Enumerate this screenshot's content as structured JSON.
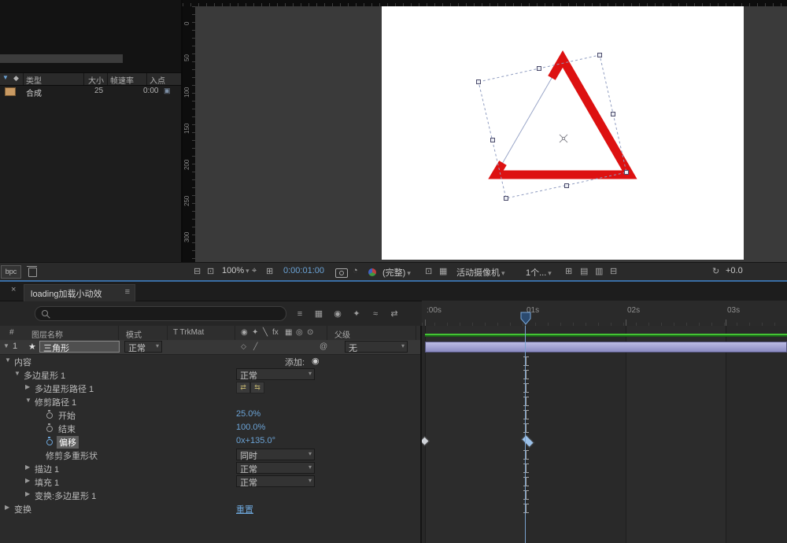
{
  "project": {
    "columns": [
      "类型",
      "大小",
      "帧速率",
      "入点"
    ],
    "row": {
      "label": "合成",
      "framerate": "25",
      "inpoint": "0:00"
    },
    "bpc_label": "bpc"
  },
  "viewer": {
    "vruler_labels": [
      "0",
      "50",
      "100",
      "150",
      "200",
      "250",
      "300"
    ],
    "toolbar": {
      "zoom": "100%",
      "timecode": "0:00:01:00",
      "resolution": "(完整)",
      "camera_view": "活动摄像机",
      "view_layout": "1个...",
      "exposure": "+0.0"
    }
  },
  "timeline": {
    "tab_label": "loading加载小动效",
    "columns": {
      "index": "#",
      "name": "图层名称",
      "mode": "模式",
      "trkmat": "T TrkMat",
      "parent": "父级"
    },
    "layer": {
      "index": "1",
      "name": "三角形",
      "mode": "正常",
      "parent": "无"
    },
    "add_label": "添加:",
    "ruler_labels": [
      ":00s",
      "01s",
      "02s",
      "03s"
    ],
    "rows": [
      {
        "label": "内容",
        "expander": "▼"
      },
      {
        "label": "多边星形 1",
        "expander": "▼",
        "value": "正常"
      },
      {
        "label": "多边星形路径 1",
        "expander": "▶"
      },
      {
        "label": "修剪路径 1",
        "expander": "▼"
      },
      {
        "label": "开始",
        "value": "25.0%"
      },
      {
        "label": "结束",
        "value": "100.0%"
      },
      {
        "label": "偏移",
        "value": "0x+135.0°"
      },
      {
        "label": "修剪多重形状",
        "value": "同时"
      },
      {
        "label": "描边 1",
        "expander": "▶",
        "value": "正常"
      },
      {
        "label": "填充 1",
        "expander": "▶",
        "value": "正常"
      },
      {
        "label": "变换:多边星形 1",
        "expander": "▶"
      },
      {
        "label": "变换",
        "expander": "▶",
        "value": "重置"
      }
    ]
  },
  "icons": {
    "close": "×",
    "menu": "≡",
    "dropdown": "▾",
    "twirl_open": "▼",
    "twirl_closed": "▶",
    "tag": "◆",
    "star": "★",
    "add_button": "◉",
    "reverse_a": "⇄",
    "reverse_b": "⇆",
    "pickwhip": "@",
    "blend_a": "◇",
    "blend_b": "╱",
    "comp_item": "▣",
    "monitor_a": "⊟",
    "monitor_b": "⊡",
    "region": "⌖",
    "grid": "⊞",
    "snapshot_show": "◔",
    "roi": "⊡",
    "transparency": "▦",
    "pixel_aspect": "⊞",
    "fast_previews": "▤",
    "timeline_button": "▥",
    "flowchart": "⊟",
    "reset": "↻",
    "switches": [
      "◉",
      "✦",
      "╲",
      "fx",
      "▦",
      "◎",
      "⊙"
    ],
    "tl_toolbar": [
      "≡",
      "▦",
      "◉",
      "✦",
      "≈",
      "⇄"
    ]
  },
  "colors": {
    "accent_red": "#dd1111",
    "value_blue": "#6ba3d6",
    "cache_green": "#44c434",
    "layer_bar": "#9a9ace",
    "playhead_blue": "#7aa7d8"
  }
}
